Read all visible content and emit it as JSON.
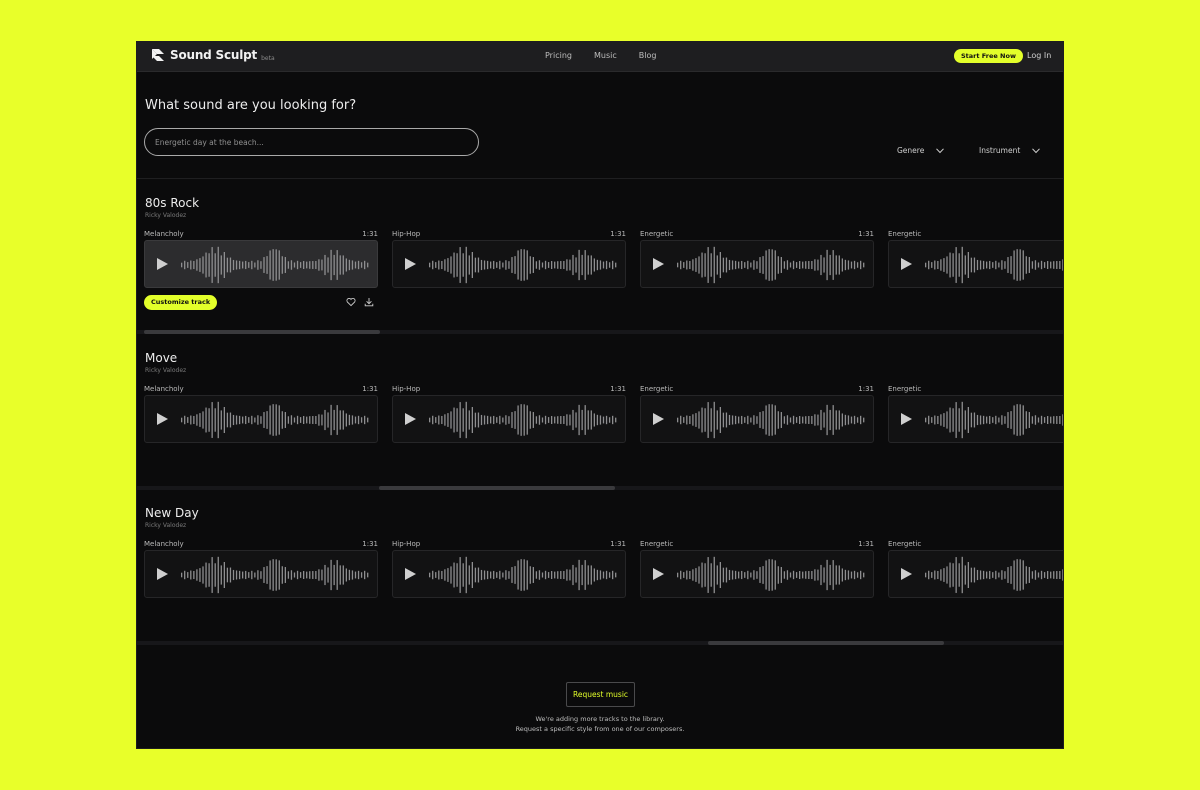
{
  "brand": {
    "name": "Sound Sculpt",
    "badge": "beta"
  },
  "nav": {
    "items": [
      "Pricing",
      "Music",
      "Blog"
    ],
    "cta": "Start Free Now",
    "login": "Log In"
  },
  "hero": {
    "title": "What sound are you looking for?",
    "search_placeholder": "Energetic day at the beach..."
  },
  "filters": {
    "genre": "Genere",
    "instrument": "Instrument"
  },
  "sections": [
    {
      "title": "80s Rock",
      "artist": "Ricky Valodez",
      "tracks": [
        {
          "genre": "Melancholy",
          "duration": "1:31"
        },
        {
          "genre": "Hip-Hop",
          "duration": "1:31"
        },
        {
          "genre": "Energetic",
          "duration": "1:31"
        },
        {
          "genre": "Energetic",
          "duration": ""
        }
      ],
      "customize_label": "Customize track"
    },
    {
      "title": "Move",
      "artist": "Ricky Valodez",
      "tracks": [
        {
          "genre": "Melancholy",
          "duration": "1:31"
        },
        {
          "genre": "Hip-Hop",
          "duration": "1:31"
        },
        {
          "genre": "Energetic",
          "duration": "1:31"
        },
        {
          "genre": "Energetic",
          "duration": ""
        }
      ]
    },
    {
      "title": "New Day",
      "artist": "Ricky Valodez",
      "tracks": [
        {
          "genre": "Melancholy",
          "duration": "1:31"
        },
        {
          "genre": "Hip-Hop",
          "duration": "1:31"
        },
        {
          "genre": "Energetic",
          "duration": "1:31"
        },
        {
          "genre": "Energetic",
          "duration": ""
        }
      ]
    }
  ],
  "request": {
    "button": "Request music",
    "line1": "We're adding more tracks to the library.",
    "line2": "Request a specific style from one of our composers."
  },
  "colors": {
    "accent": "#e3ff2a",
    "background": "#0b0b0c",
    "page_bg": "#e8ff2a"
  }
}
